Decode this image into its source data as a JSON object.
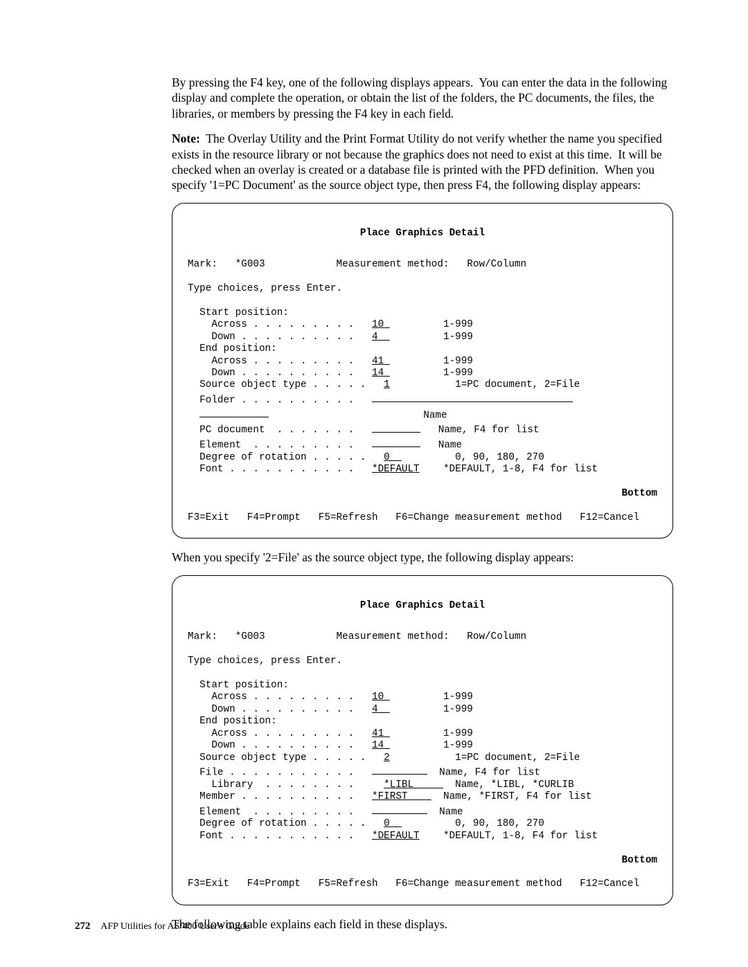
{
  "intro1": "By pressing the F4 key, one of the following displays appears.  You can enter the data in the following display and complete the operation, or obtain the list of the folders, the PC documents, the files, the libraries, or members by pressing the F4 key in each field.",
  "note_label": "Note:",
  "note_body": "  The Overlay Utility and the Print Format Utility do not verify whether the name you specified exists in the resource library or not because the graphics does not need to exist at this time.  It will be checked when an overlay is created or a database file is printed with the PFD definition.  When you specify '1=PC Document' as the source object type, then press F4, the following display appears:",
  "mid_text": "When you specify '2=File' as the source object type, the following display appears:",
  "end_text": "The following table explains each field in these displays.",
  "screen_title": "Place Graphics Detail",
  "mark_label": "Mark:",
  "mark_value": "*G003",
  "meas_label": "Measurement method:",
  "meas_value": "Row/Column",
  "type_choices": "Type choices, press Enter.",
  "start_pos": "Start position:",
  "end_pos": "End position:",
  "across": "Across",
  "down": "Down",
  "src_obj_type": "Source object type",
  "folder": "Folder",
  "pc_doc": "PC document",
  "element": "Element",
  "degree": "Degree of rotation",
  "font": "Font",
  "file": "File",
  "library": "Library",
  "member": "Member",
  "val_10": "10",
  "val_4": "4",
  "val_41": "41",
  "val_14": "14",
  "val_1": "1",
  "val_2": "2",
  "val_0": "0",
  "val_libl": "*LIBL",
  "val_first": "*FIRST",
  "val_default": "*DEFAULT",
  "rng_1_999": "1-999",
  "rng_src": "1=PC document, 2=File",
  "rng_name": "Name",
  "rng_name_f4": "Name, F4 for list",
  "rng_libl": "Name, *LIBL, *CURLIB",
  "rng_first": "Name, *FIRST, F4 for list",
  "rng_deg": "0, 90, 180, 270",
  "rng_font": "*DEFAULT, 1-8, F4 for list",
  "bottom": "Bottom",
  "fkeys": "F3=Exit   F4=Prompt   F5=Refresh   F6=Change measurement method   F12=Cancel",
  "page_num": "272",
  "book_title": "AFP Utilities for AS/400 User's Guide"
}
